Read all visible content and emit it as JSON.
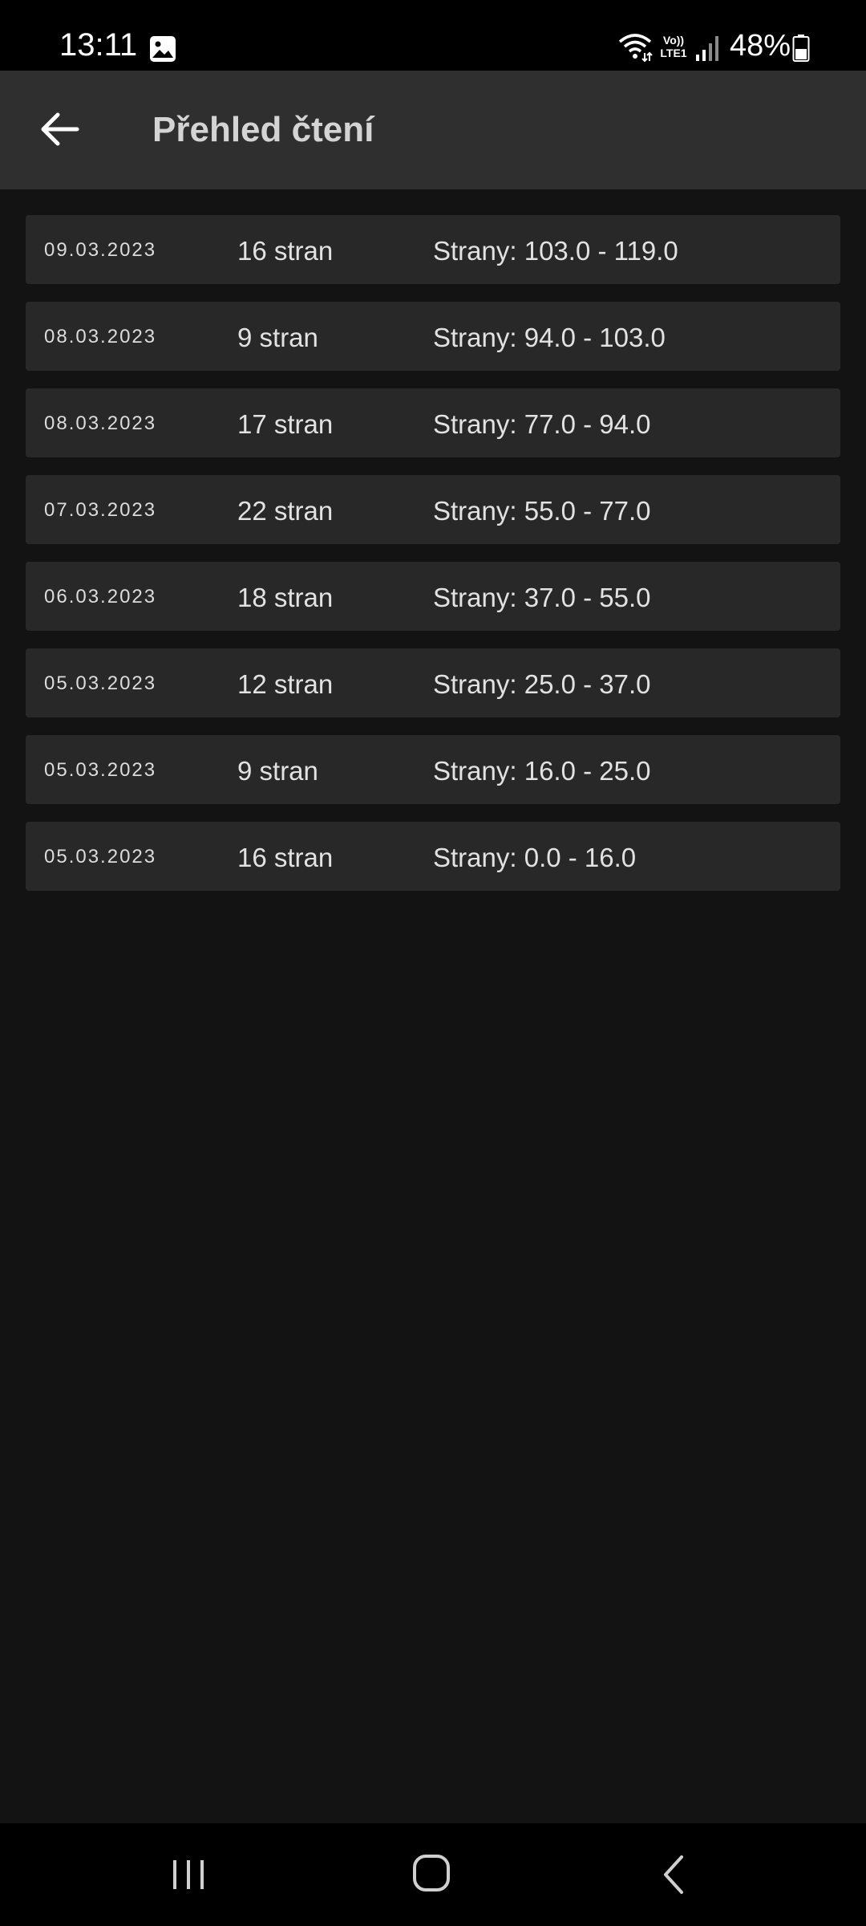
{
  "status_bar": {
    "time": "13:11",
    "volte_line1": "Vo))",
    "volte_line2": "LTE1",
    "battery": "48%"
  },
  "app_bar": {
    "title": "Přehled čtení"
  },
  "entries": [
    {
      "date": "09.03.2023",
      "count": "16 stran",
      "range": "Strany: 103.0 - 119.0"
    },
    {
      "date": "08.03.2023",
      "count": "9 stran",
      "range": "Strany: 94.0 - 103.0"
    },
    {
      "date": "08.03.2023",
      "count": "17 stran",
      "range": "Strany: 77.0 - 94.0"
    },
    {
      "date": "07.03.2023",
      "count": "22 stran",
      "range": "Strany: 55.0 - 77.0"
    },
    {
      "date": "06.03.2023",
      "count": "18 stran",
      "range": "Strany: 37.0 - 55.0"
    },
    {
      "date": "05.03.2023",
      "count": "12 stran",
      "range": "Strany: 25.0 - 37.0"
    },
    {
      "date": "05.03.2023",
      "count": "9 stran",
      "range": "Strany: 16.0 - 25.0"
    },
    {
      "date": "05.03.2023",
      "count": "16 stran",
      "range": "Strany: 0.0 - 16.0"
    }
  ],
  "icons": {
    "status": [
      "gallery-icon",
      "wifi-icon",
      "volte-icon",
      "signal-icon",
      "battery-icon"
    ],
    "app_bar": "back-arrow-icon",
    "nav": [
      "recents-icon",
      "home-icon",
      "back-icon"
    ]
  },
  "colors": {
    "background": "#131313",
    "app_bar": "#2f2f2f",
    "row": "#282828",
    "status_bar": "#000000"
  }
}
